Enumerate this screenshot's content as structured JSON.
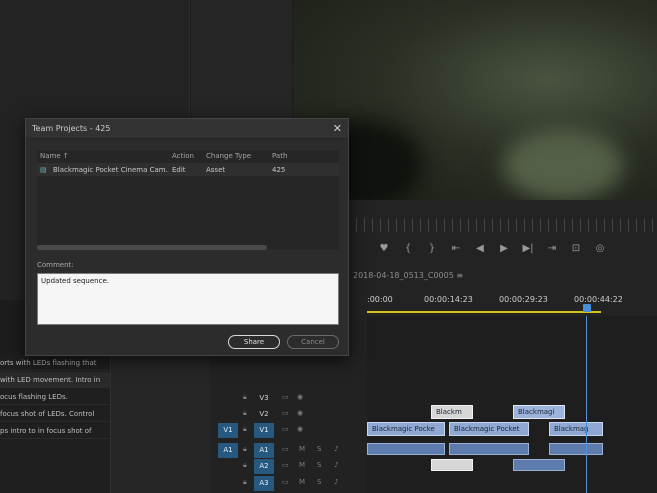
{
  "dialog": {
    "title": "Team Projects - 425",
    "close": "✕",
    "columns": {
      "name": "Name ↑",
      "action": "Action",
      "change_type": "Change Type",
      "path": "Path"
    },
    "rows": [
      {
        "name": "Blackmagic Pocket Cinema Cam...",
        "action": "Edit",
        "change_type": "Asset",
        "path": "425"
      }
    ],
    "comment_label": "Comment:",
    "comment_value": "Updated sequence.",
    "share_label": "Share",
    "cancel_label": "Cancel"
  },
  "sequence": {
    "tab_name": "2018-04-18_0513_C0005  ≡",
    "timecodes": [
      ":00:00",
      "00:00:14:23",
      "00:00:29:23",
      "00:00:44:22"
    ]
  },
  "project_list": [
    "orts with LEDs flashing that",
    "with LED movement. Intro in",
    "ocus flashing LEDs.",
    "focus shot of LEDs. Control",
    "ps intro to in focus shot of"
  ],
  "tracks": {
    "v3": "V3",
    "v2": "V2",
    "v1": "V1",
    "a1": "A1",
    "a2": "A2",
    "a3": "A3",
    "src_v1": "V1",
    "src_a1": "A1"
  },
  "clips": {
    "title_1": "Blackm",
    "title_2": "Blackmagi",
    "video_1": "Blackmagic Pocke",
    "video_2": "Blackmagic Pocket",
    "video_3": "Blackmag"
  },
  "transport": [
    "♥",
    "{",
    "}",
    "⇤",
    "◀",
    "▶",
    "▶|",
    "⇥",
    "⊡",
    "◎"
  ]
}
